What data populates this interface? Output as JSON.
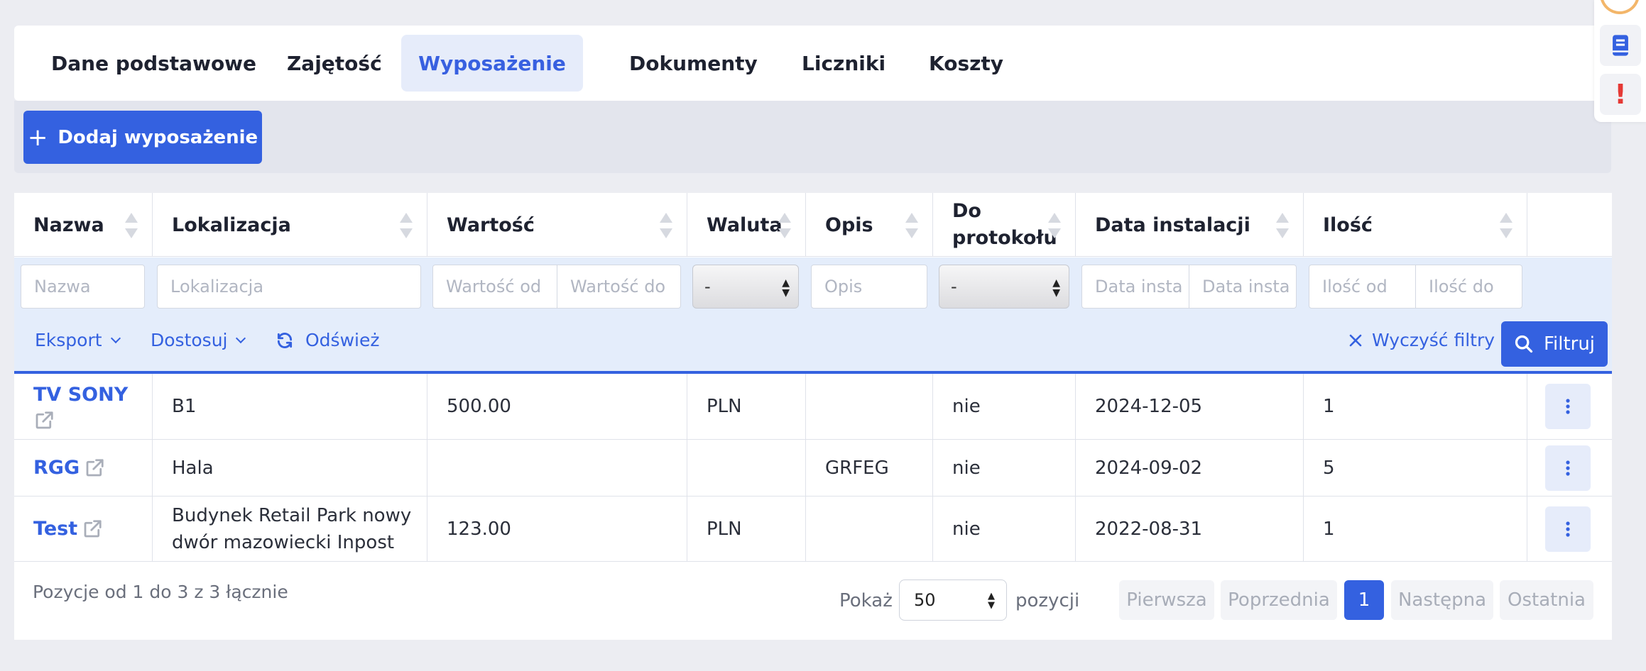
{
  "tabs": [
    {
      "label": "Dane podstawowe",
      "active": false
    },
    {
      "label": "Zajętość",
      "active": false
    },
    {
      "label": "Wyposażenie",
      "active": true
    },
    {
      "label": "Dokumenty",
      "active": false
    },
    {
      "label": "Liczniki",
      "active": false
    },
    {
      "label": "Koszty",
      "active": false
    }
  ],
  "toolbar": {
    "add_label": "Dodaj wyposażenie"
  },
  "table": {
    "columns": [
      "Nazwa",
      "Lokalizacja",
      "Wartość",
      "Waluta",
      "Opis",
      "Do protokołu",
      "Data instalacji",
      "Ilość"
    ],
    "filters": {
      "nazwa": "Nazwa",
      "lokalizacja": "Lokalizacja",
      "wartosc_od": "Wartość od",
      "wartosc_do": "Wartość do",
      "waluta": "-",
      "opis": "Opis",
      "do_protokolu": "-",
      "data_od": "Data insta",
      "data_do": "Data insta",
      "ilosc_od": "Ilość od",
      "ilosc_do": "Ilość do"
    },
    "tools": {
      "eksport": "Eksport",
      "dostosuj": "Dostosuj",
      "odswiez": "Odśwież",
      "clear": "Wyczyść filtry",
      "filter": "Filtruj"
    },
    "rows": [
      {
        "nazwa": "TV SONY",
        "lokalizacja": "B1",
        "wartosc": "500.00",
        "waluta": "PLN",
        "opis": "",
        "do_protokolu": "nie",
        "data": "2024-12-05",
        "ilosc": "1"
      },
      {
        "nazwa": "RGG",
        "lokalizacja": "Hala",
        "wartosc": "",
        "waluta": "",
        "opis": "GRFEG",
        "do_protokolu": "nie",
        "data": "2024-09-02",
        "ilosc": "5"
      },
      {
        "nazwa": "Test",
        "lokalizacja": "Budynek Retail Park nowy dwór mazowiecki Inpost",
        "wartosc": "123.00",
        "waluta": "PLN",
        "opis": "",
        "do_protokolu": "nie",
        "data": "2022-08-31",
        "ilosc": "1"
      }
    ]
  },
  "footer": {
    "info": "Pozycje od 1 do 3 z 3 łącznie",
    "show_label": "Pokaż",
    "page_size": "50",
    "items_label": "pozycji",
    "pagination": {
      "first": "Pierwsza",
      "prev": "Poprzednia",
      "current": "1",
      "next": "Następna",
      "last": "Ostatnia"
    }
  },
  "colors": {
    "accent": "#3461e0",
    "active_tab_bg": "#e6ecfa",
    "filter_bg": "#e4edfb",
    "alert": "#e53935"
  },
  "side_panel": {
    "icons": [
      "avatar-icon",
      "book-icon",
      "alert-icon"
    ],
    "alert_symbol": "!"
  }
}
